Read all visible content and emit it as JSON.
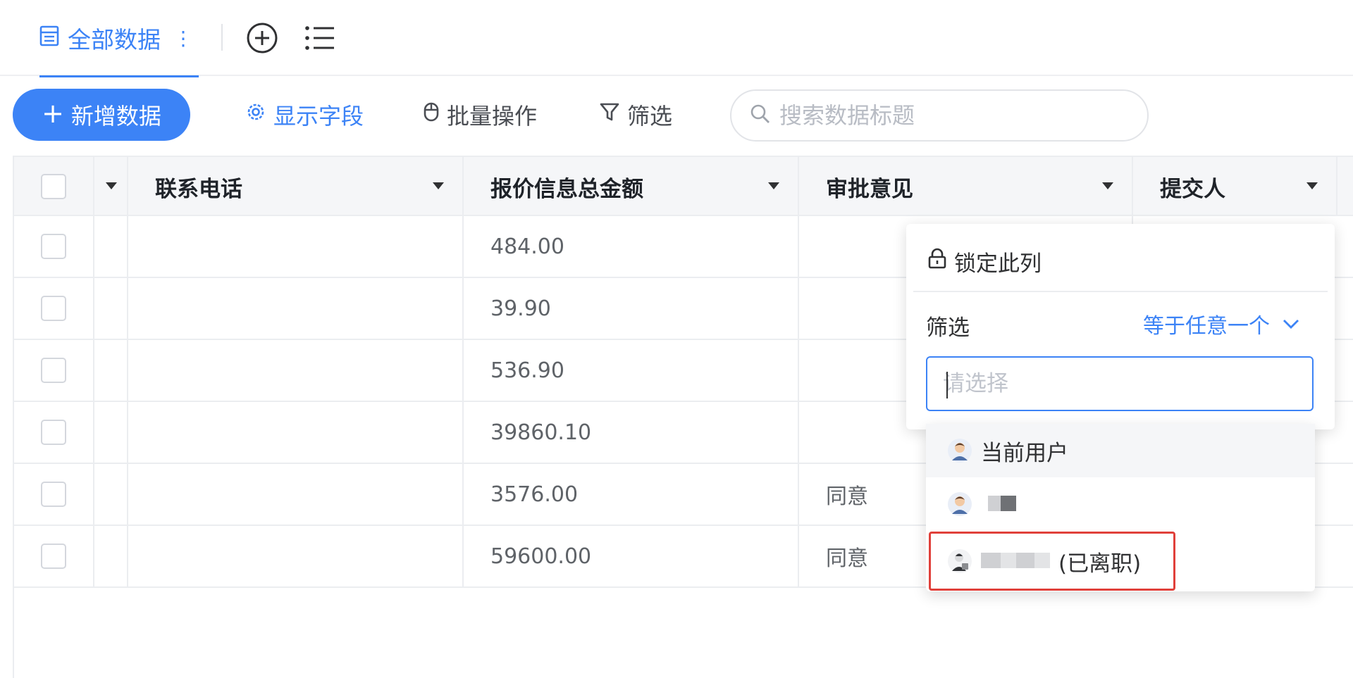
{
  "tabs": {
    "current_view": "全部数据",
    "more": "⋮"
  },
  "toolbar": {
    "add_label": "新增数据",
    "fields_label": "显示字段",
    "batch_label": "批量操作",
    "filter_label": "筛选",
    "search_placeholder": "搜索数据标题"
  },
  "table": {
    "columns": [
      "联系电话",
      "报价信息总金额",
      "审批意见",
      "提交人"
    ],
    "rows": [
      {
        "phone": "",
        "amount": "484.00",
        "opinion": ""
      },
      {
        "phone": "",
        "amount": "39.90",
        "opinion": ""
      },
      {
        "phone": "",
        "amount": "536.90",
        "opinion": ""
      },
      {
        "phone": "",
        "amount": "39860.10",
        "opinion": ""
      },
      {
        "phone": "",
        "amount": "3576.00",
        "opinion": "同意"
      },
      {
        "phone": "",
        "amount": "59600.00",
        "opinion": "同意"
      }
    ]
  },
  "column_menu": {
    "lock_label": "锁定此列",
    "filter_label": "筛选",
    "filter_mode": "等于任意一个",
    "select_placeholder": "请选择",
    "options": [
      {
        "label": "当前用户"
      },
      {
        "label": ""
      },
      {
        "label": "(已离职)"
      }
    ]
  },
  "colors": {
    "accent": "#3c83f6",
    "highlight": "#e0403a"
  }
}
